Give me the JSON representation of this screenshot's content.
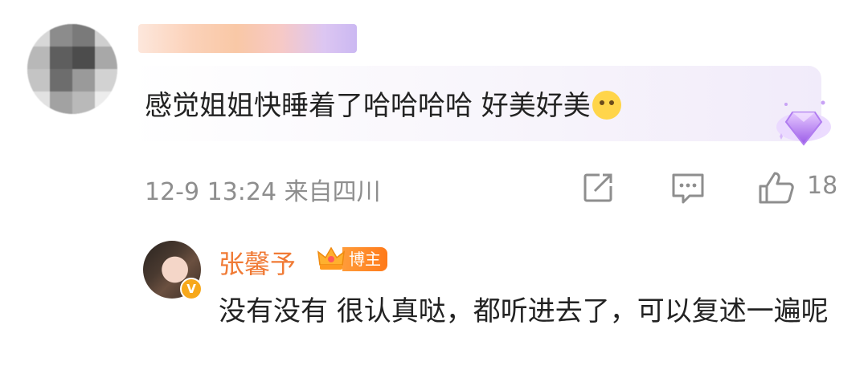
{
  "comment": {
    "text": "感觉姐姐快睡着了哈哈哈哈 好美好美",
    "emoji_icon": "pleading-face-emoji-icon",
    "badge_icon": "purple-diamond-badge-icon",
    "timestamp": "12-9 13:24",
    "location": "来自四川",
    "like_count": "18"
  },
  "reply": {
    "author": "张馨予",
    "author_color": "#f07a35",
    "role_badge": "博主",
    "verified_icon": "verified-v-icon",
    "text": "没有没有 很认真哒，都听进去了，可以复述一遍呢"
  },
  "actions": {
    "share_icon": "share-icon",
    "comment_icon": "comment-icon",
    "like_icon": "thumbs-up-icon"
  }
}
